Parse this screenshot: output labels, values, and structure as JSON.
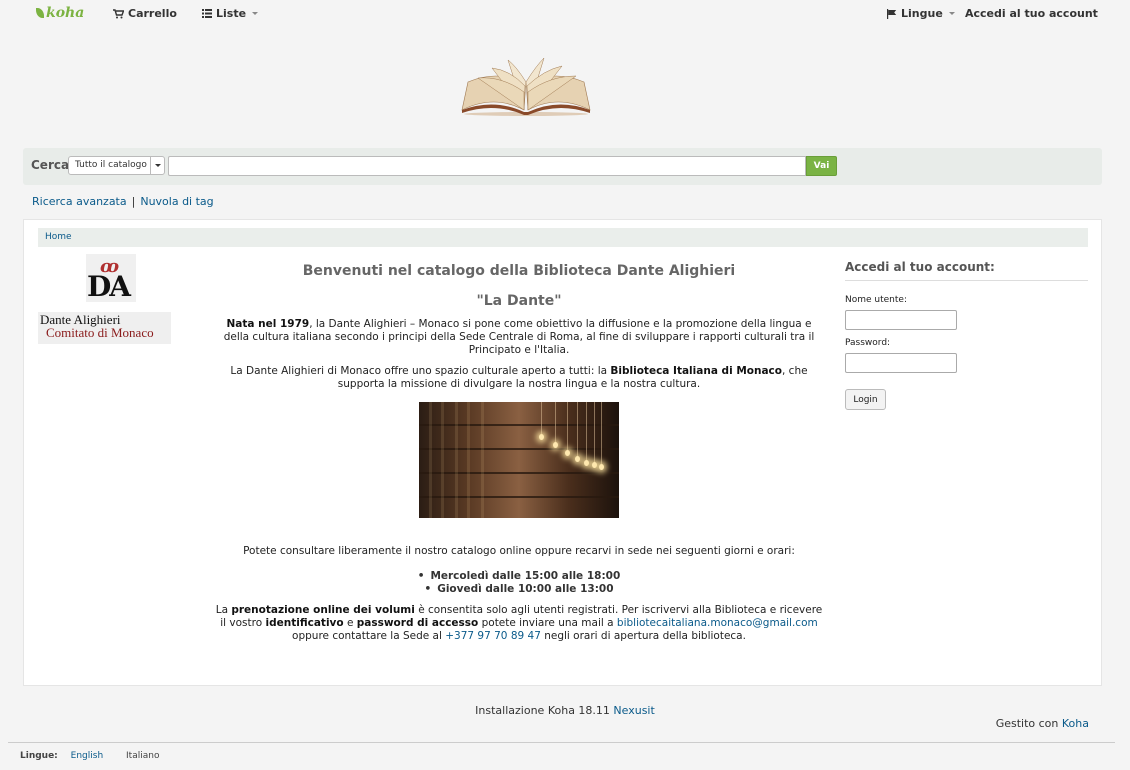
{
  "navbar": {
    "logo": "koha",
    "cart": "Carrello",
    "lists": "Liste",
    "languages": "Lingue",
    "login": "Accedi al tuo account"
  },
  "search": {
    "label": "Cerca",
    "scope": "Tutto il catalogo",
    "query": "",
    "go": "Vai"
  },
  "links": {
    "advanced": "Ricerca avanzata",
    "separator": "|",
    "tag_cloud": "Nuvola di tag"
  },
  "breadcrumb": {
    "home": "Home"
  },
  "logo_block": {
    "mark": "DA",
    "line1": "Dante Alighieri",
    "line2": "Comitato di Monaco"
  },
  "content": {
    "title": "Benvenuti nel catalogo della Biblioteca Dante Alighieri",
    "subtitle": "\"La Dante\"",
    "p1_bold": "Nata nel 1979",
    "p1_rest": ", la Dante Alighieri – Monaco si pone come obiettivo la diffusione e la promozione della lingua e della cultura italiana secondo i principi della Sede Centrale di Roma, al fine di sviluppare i rapporti culturali tra il Principato e l'Italia.",
    "p2_start": "La Dante Alighieri di Monaco offre uno spazio culturale aperto a tutti: la ",
    "p2_bold": "Biblioteca Italiana di Monaco",
    "p2_end": ", che supporta la missione di divulgare la nostra lingua e la nostra cultura.",
    "p3": "Potete consultare liberamente il nostro catalogo online oppure recarvi in sede nei seguenti giorni e orari:",
    "hours": [
      "Mercoledì dalle 15:00 alle 18:00",
      "Giovedì dalle 10:00 alle 13:00"
    ],
    "p4_a": "La ",
    "p4_b": "prenotazione online dei volumi",
    "p4_c": " è consentita solo agli utenti registrati. Per iscrivervi alla Biblioteca e ricevere il vostro ",
    "p4_d": "identificativo",
    "p4_e": " e ",
    "p4_f": "password di accesso",
    "p4_g": " potete inviare una mail a ",
    "email": "bibliotecaitaliana.monaco@gmail.com",
    "p4_h": " oppure contattare la Sede al ",
    "phone": "+377 97 70 89 47",
    "p4_i": " negli orari di apertura della biblioteca."
  },
  "login": {
    "title": "Accedi al tuo account:",
    "username_label": "Nome utente:",
    "password_label": "Password:",
    "button": "Login"
  },
  "footer": {
    "install_text": "Installazione Koha 18.11 ",
    "install_link": "Nexusit",
    "managed_text": "Gestito con ",
    "managed_link": "Koha",
    "languages_label": "Lingue:",
    "lang_en": "English",
    "lang_it": "Italiano"
  },
  "colors": {
    "accent_green": "#7ab344",
    "link_blue": "#0a5a8a"
  }
}
